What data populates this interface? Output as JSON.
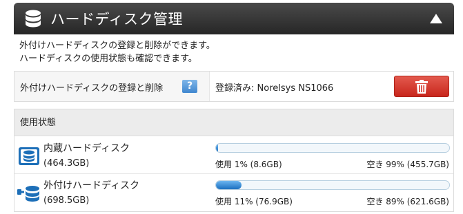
{
  "header": {
    "title": "ハードディスク管理",
    "icon": "database-icon",
    "collapse_icon": "triangle-up-icon"
  },
  "description": {
    "line1": "外付けハードディスクの登録と削除ができます。",
    "line2": "ハードディスクの使用状態も確認できます。"
  },
  "registration": {
    "label": "外付けハードディスクの登録と削除",
    "help_label": "?",
    "status": "登録済み: Norelsys NS1066",
    "delete_icon": "trash-icon"
  },
  "usage": {
    "heading": "使用状態",
    "disks": [
      {
        "name": "内蔵ハードディスク",
        "size": "(464.3GB)",
        "used": "使用 1% (8.6GB)",
        "free": "空き 99% (455.7GB)",
        "used_fraction": 0.01,
        "icon": "internal-disk-icon"
      },
      {
        "name": "外付けハードディスク",
        "size": "(698.5GB)",
        "used": "使用 11% (76.9GB)",
        "free": "空き 89% (621.6GB)",
        "used_fraction": 0.11,
        "icon": "external-disk-icon"
      }
    ]
  },
  "colors": {
    "header_bg": "#333333",
    "delete_button": "#d6352a",
    "help_button": "#4a90d9",
    "bar_fill": "#2f86d6",
    "icon_blue": "#1d6fb8"
  }
}
